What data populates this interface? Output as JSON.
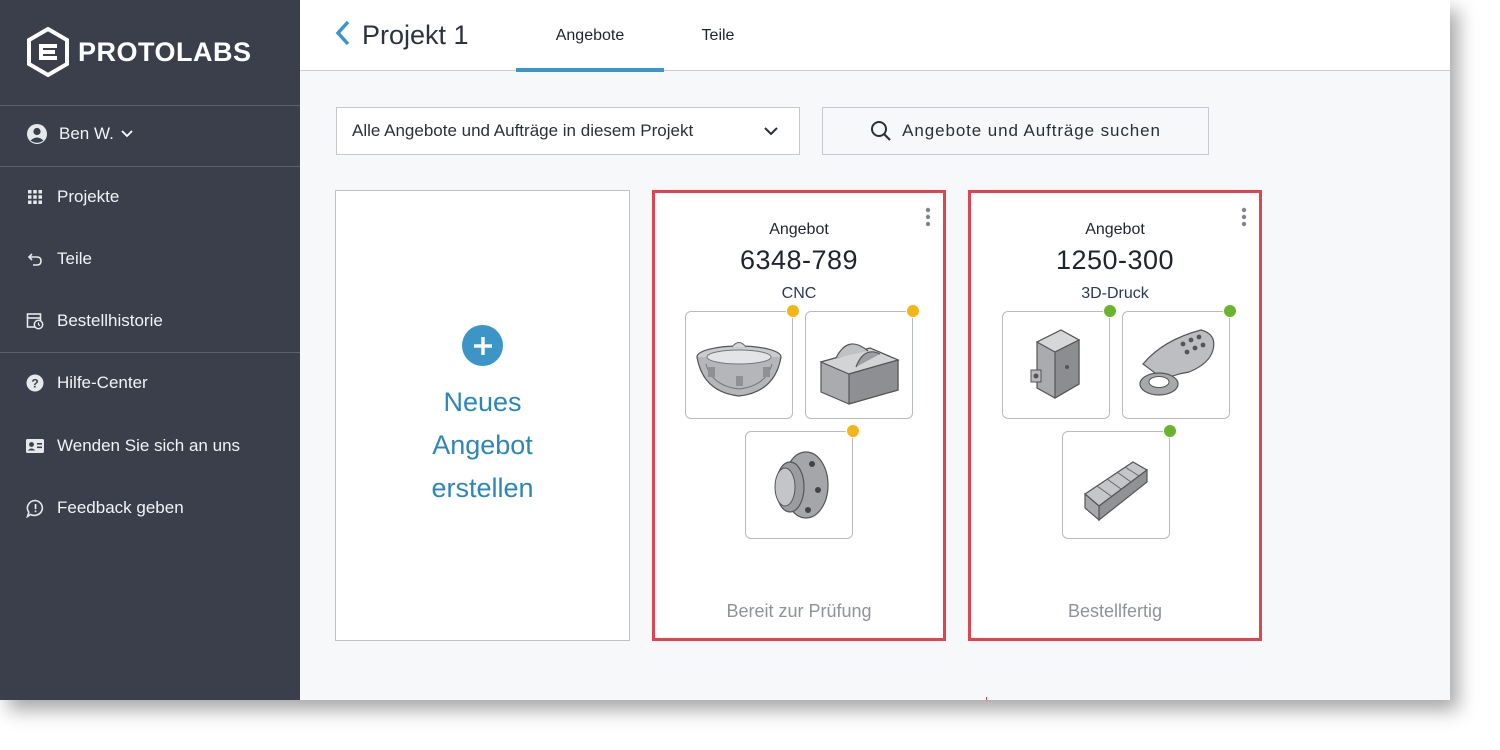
{
  "brand": {
    "name": "PROTOLABS"
  },
  "user": {
    "name": "Ben W."
  },
  "sidebar": {
    "items": [
      {
        "label": "Projekte",
        "icon": "grid-icon"
      },
      {
        "label": "Teile",
        "icon": "undo-arrow-icon"
      },
      {
        "label": "Bestellhistorie",
        "icon": "order-history-icon"
      },
      {
        "label": "Hilfe-Center",
        "icon": "help-icon"
      },
      {
        "label": "Wenden Sie sich an uns",
        "icon": "contact-card-icon"
      },
      {
        "label": "Feedback geben",
        "icon": "feedback-icon"
      }
    ]
  },
  "header": {
    "title": "Projekt 1",
    "tabs": [
      {
        "label": "Angebote",
        "active": true
      },
      {
        "label": "Teile",
        "active": false
      }
    ]
  },
  "filters": {
    "select_value": "Alle Angebote und Aufträge in diesem Projekt",
    "search_label": "Angebote und Aufträge suchen"
  },
  "new_quote": {
    "label": "Neues Angebot erstellen",
    "lines": [
      "Neues",
      "Angebot",
      "erstellen"
    ]
  },
  "quotes": [
    {
      "label": "Angebot",
      "number": "6348-789",
      "process": "CNC",
      "status": "Bereit zur Prüfung",
      "status_color": "#f5b418",
      "parts": [
        "dome-part",
        "block-part",
        "flange-part"
      ]
    },
    {
      "label": "Angebot",
      "number": "1250-300",
      "process": "3D-Druck",
      "status": "Bestellfertig",
      "status_color": "#6ab42d",
      "parts": [
        "housing-part",
        "bracket-part",
        "rail-part"
      ]
    }
  ],
  "colors": {
    "sidebar_bg": "#3a3f4b",
    "accent": "#3b95c6",
    "highlight_border": "#e0444f",
    "status_yellow": "#f5b418",
    "status_green": "#6ab42d"
  }
}
